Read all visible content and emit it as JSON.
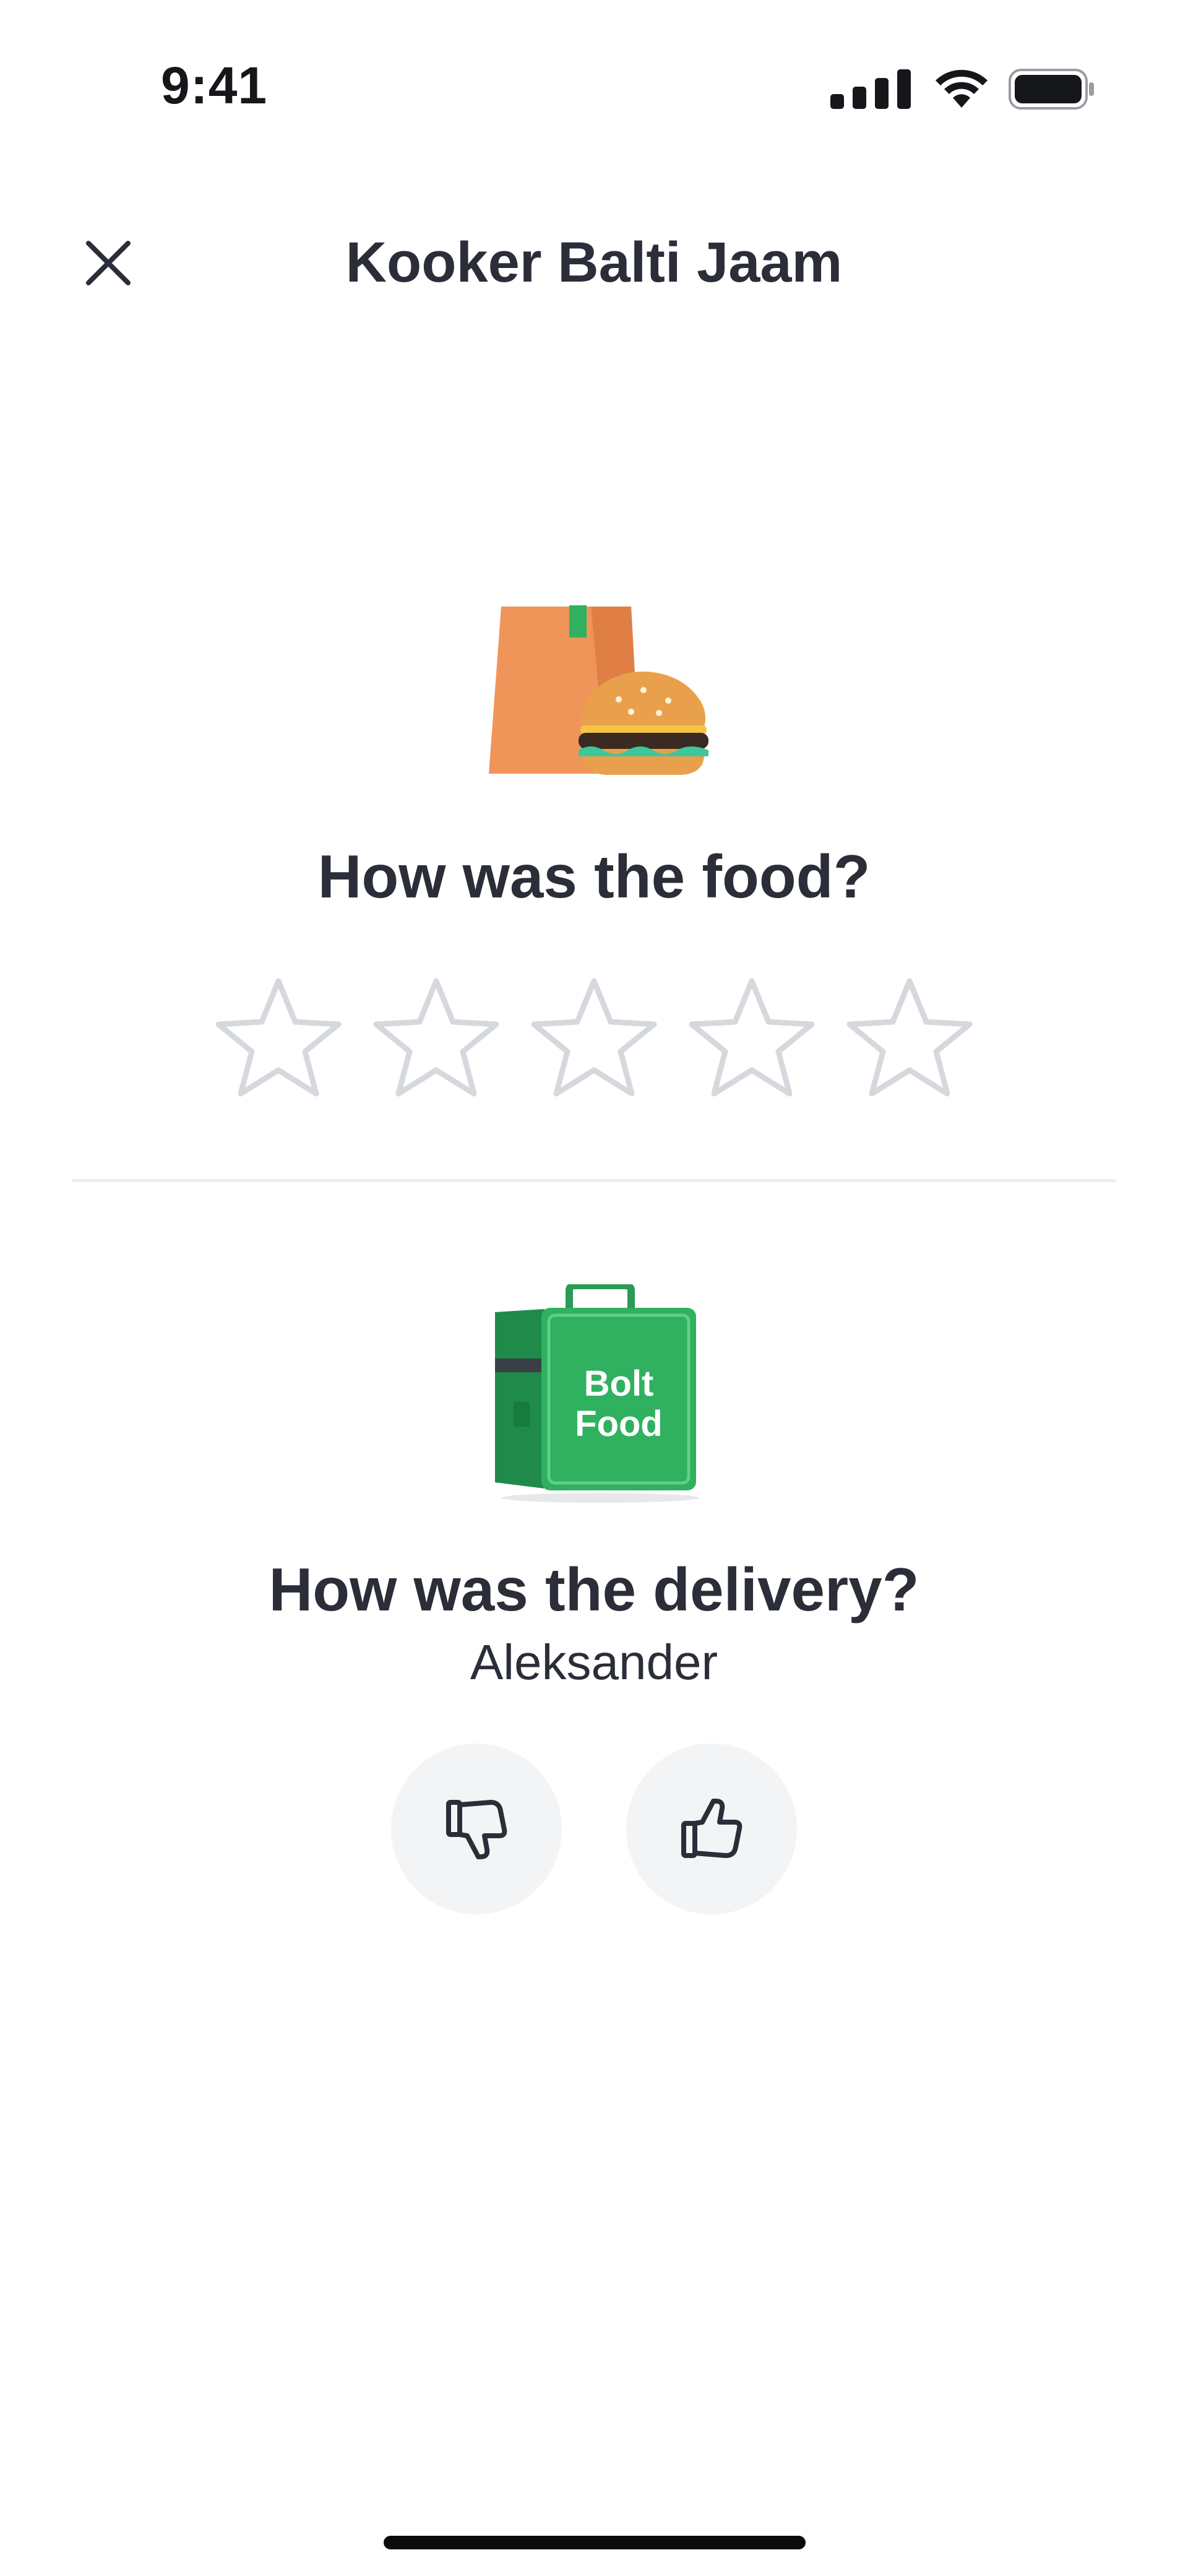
{
  "status_bar": {
    "time": "9:41",
    "icons": [
      "cellular-signal-icon",
      "wifi-icon",
      "battery-icon"
    ]
  },
  "header": {
    "title": "Kooker Balti Jaam",
    "close_icon": "close-icon"
  },
  "food_section": {
    "illustration": "food-bag-burger-illustration",
    "question": "How was the food?",
    "rating": {
      "max_stars": 5,
      "selected": 0
    }
  },
  "delivery_section": {
    "illustration": "bolt-food-bag-illustration",
    "bag_logo_line1": "Bolt",
    "bag_logo_line2": "Food",
    "question": "How was the delivery?",
    "courier_name": "Aleksander",
    "buttons": [
      "thumbs-down-icon",
      "thumbs-up-icon"
    ]
  },
  "colors": {
    "text_primary": "#2b2e38",
    "star_outline": "#d5d8dd",
    "button_bg": "#f3f4f5",
    "divider": "#eceef0",
    "brand_green": "#2fb15f"
  }
}
